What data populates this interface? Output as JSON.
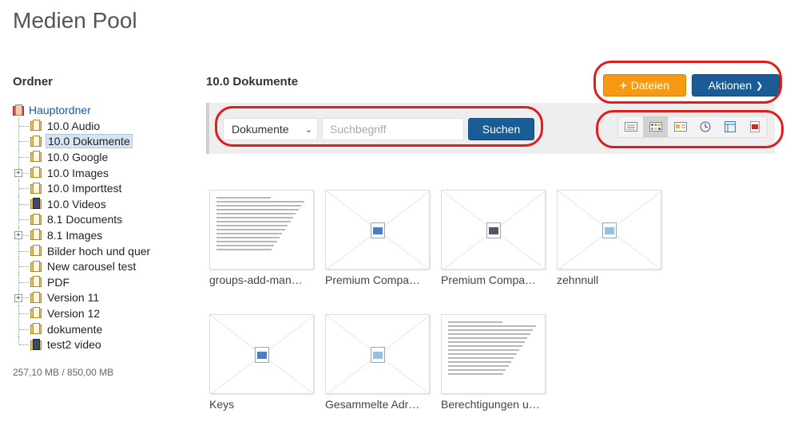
{
  "page": {
    "title": "Medien Pool"
  },
  "sidebar": {
    "heading": "Ordner",
    "root": "Hauptordner",
    "folders": [
      {
        "label": "10.0 Audio",
        "expandable": false,
        "icon": "folder-icon"
      },
      {
        "label": "10.0 Dokumente",
        "expandable": false,
        "icon": "folder-icon",
        "selected": true
      },
      {
        "label": "10.0 Google",
        "expandable": false,
        "icon": "folder-icon"
      },
      {
        "label": "10.0 Images",
        "expandable": true,
        "icon": "folder-icon"
      },
      {
        "label": "10.0 Importtest",
        "expandable": false,
        "icon": "folder-icon"
      },
      {
        "label": "10.0 Videos",
        "expandable": false,
        "icon": "video-folder-icon"
      },
      {
        "label": "8.1 Documents",
        "expandable": false,
        "icon": "folder-icon"
      },
      {
        "label": "8.1 Images",
        "expandable": true,
        "icon": "folder-icon"
      },
      {
        "label": "Bilder hoch und quer",
        "expandable": false,
        "icon": "folder-icon"
      },
      {
        "label": "New carousel test",
        "expandable": false,
        "icon": "folder-icon"
      },
      {
        "label": "PDF",
        "expandable": false,
        "icon": "folder-icon"
      },
      {
        "label": "Version 11",
        "expandable": true,
        "icon": "folder-icon"
      },
      {
        "label": "Version 12",
        "expandable": false,
        "icon": "folder-icon"
      },
      {
        "label": "dokumente",
        "expandable": false,
        "icon": "folder-icon"
      },
      {
        "label": "test2 video",
        "expandable": false,
        "icon": "video-folder-icon"
      }
    ],
    "storage": "257,10 MB / 850,00 MB"
  },
  "main": {
    "title": "10.0 Dokumente",
    "upload_label": "Dateien",
    "actions_label": "Aktionen",
    "filter_value": "Dokumente",
    "search_placeholder": "Suchbegriff",
    "search_label": "Suchen",
    "view_modes": [
      "list-view-icon",
      "grid-view-icon",
      "detail-view-icon",
      "clock-view-icon",
      "table-view-icon",
      "pdf-view-icon"
    ],
    "items": [
      {
        "name": "groups-add-man…",
        "type": "doc-preview"
      },
      {
        "name": "Premium Compa…",
        "type": "word"
      },
      {
        "name": "Premium Compa…",
        "type": "presentation"
      },
      {
        "name": "zehnnull",
        "type": "text"
      },
      {
        "name": "Keys",
        "type": "word"
      },
      {
        "name": "Gesammelte Adr…",
        "type": "text"
      },
      {
        "name": "Berechtigungen u…",
        "type": "doc-preview"
      }
    ]
  },
  "colors": {
    "accent": "#1a5d96",
    "upload": "#f59a12",
    "annotation": "#e01c1c",
    "link": "#1a5aa0"
  }
}
